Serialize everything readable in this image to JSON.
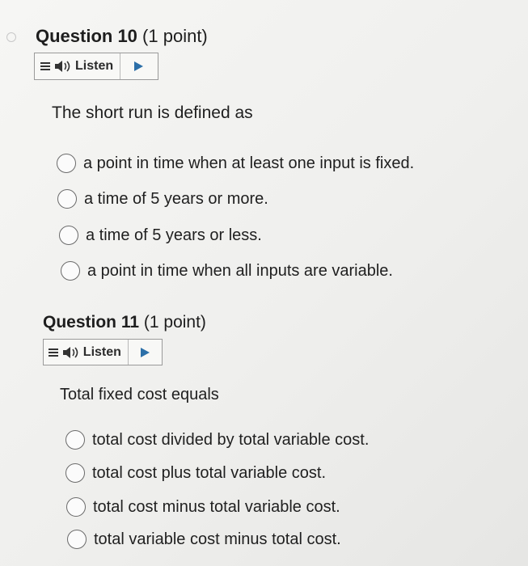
{
  "questions": [
    {
      "number_label": "Question 10",
      "points_label": "(1 point)",
      "listen_label": "Listen",
      "prompt": "The short run is defined as",
      "options": [
        "a point in time when at least one input is fixed.",
        "a time of 5 years or more.",
        "a time of 5 years or less.",
        "a point in time when all inputs are variable."
      ]
    },
    {
      "number_label": "Question 11",
      "points_label": "(1 point)",
      "listen_label": "Listen",
      "prompt": "Total fixed cost equals",
      "options": [
        "total cost divided by total variable cost.",
        "total cost plus total variable cost.",
        "total cost minus total variable cost.",
        "total variable cost minus total cost."
      ]
    }
  ],
  "icons": {
    "menu": "hamburger-icon",
    "speaker": "speaker-icon",
    "play": "play-icon"
  },
  "colors": {
    "play": "#2c6fa8",
    "text": "#1f1f1f",
    "radio_border": "#6a6a6a"
  }
}
